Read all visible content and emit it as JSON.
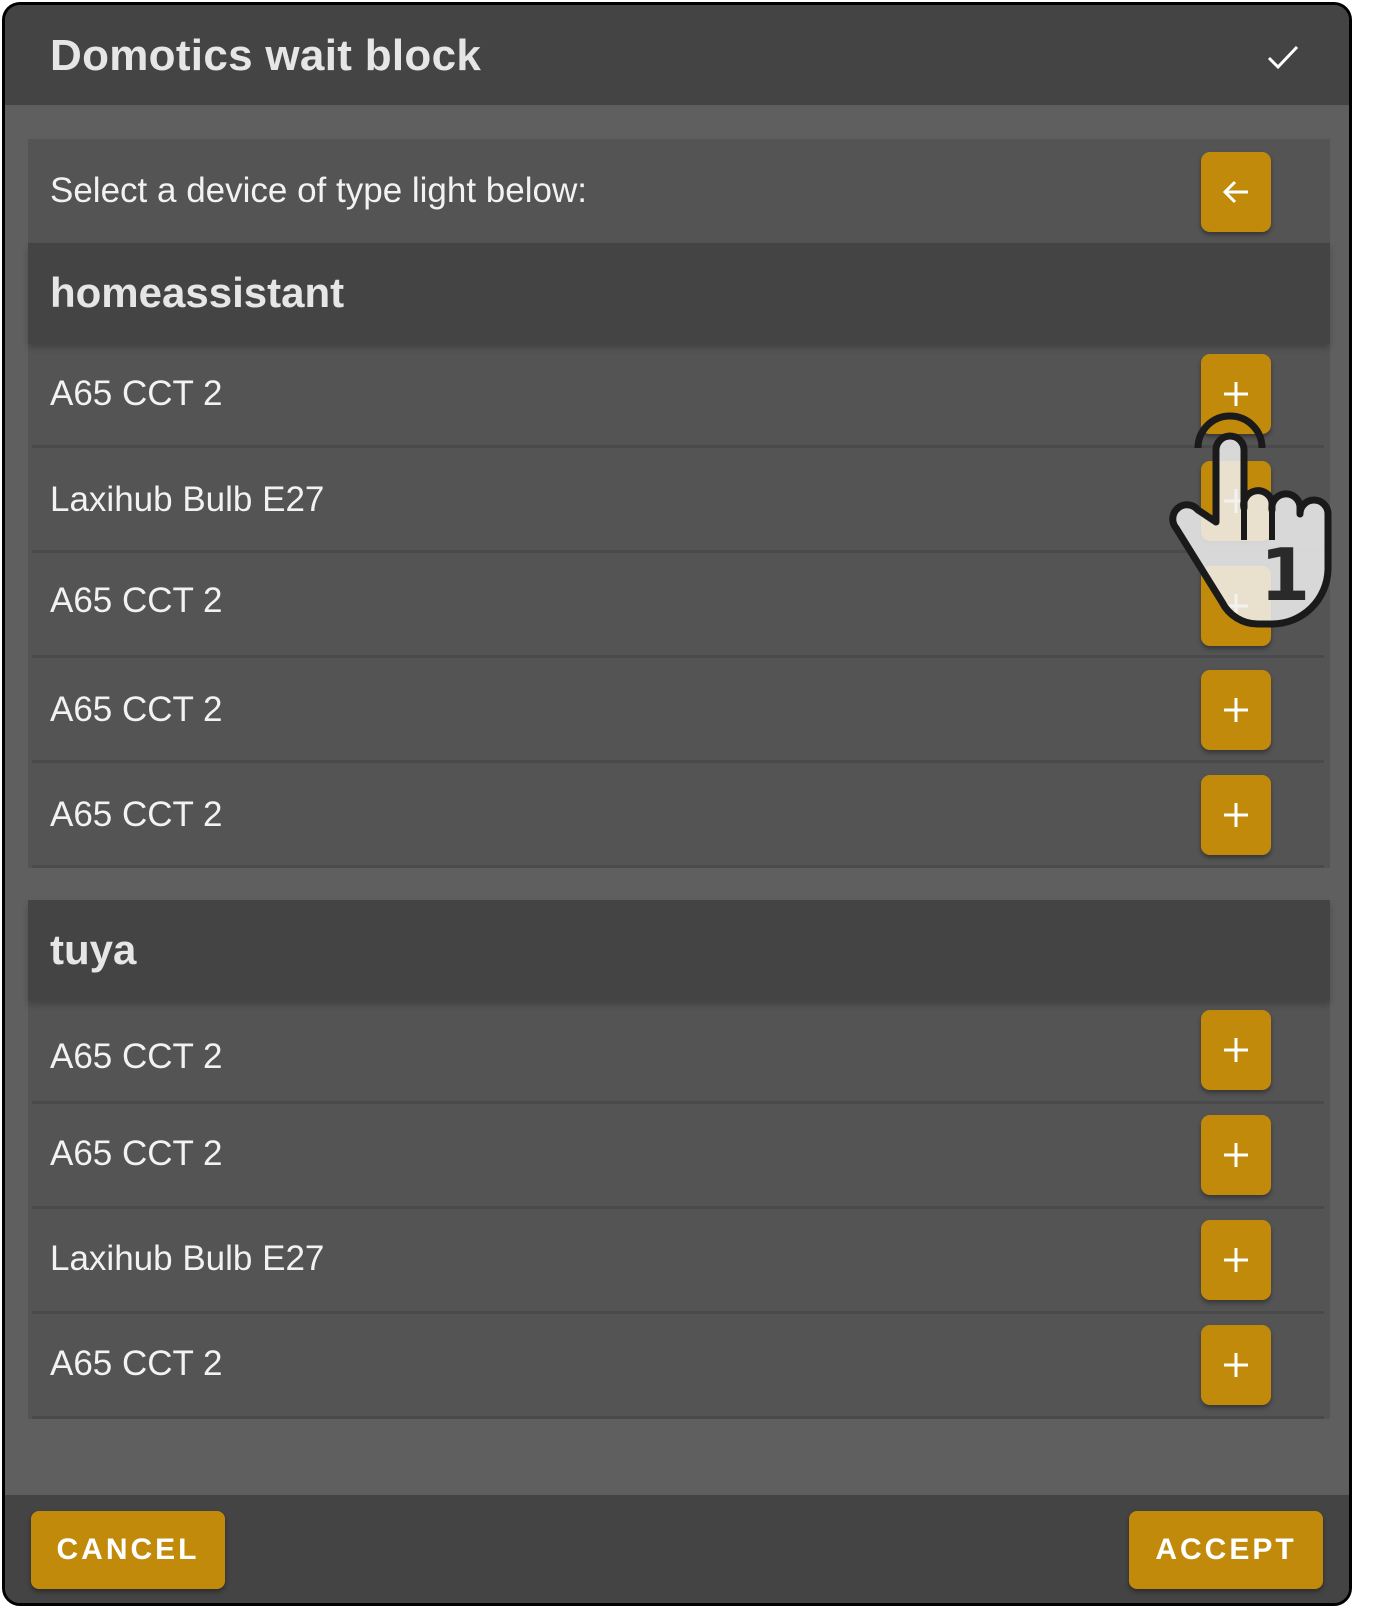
{
  "dialog": {
    "title": "Domotics wait block",
    "confirm_icon": "check-icon"
  },
  "prompt": {
    "label": "Select a device of type light below:",
    "back_icon": "arrow-left-icon"
  },
  "groups": [
    {
      "name": "homeassistant",
      "items": [
        {
          "label": "A65 CCT 2",
          "action_icon": "plus-icon"
        },
        {
          "label": "Laxihub Bulb E27",
          "action_icon": "plus-icon"
        },
        {
          "label": "A65 CCT 2",
          "action_icon": "plus-icon"
        },
        {
          "label": "A65 CCT 2",
          "action_icon": "plus-icon"
        },
        {
          "label": "A65 CCT 2",
          "action_icon": "plus-icon"
        }
      ]
    },
    {
      "name": "tuya",
      "items": [
        {
          "label": "A65 CCT 2",
          "action_icon": "plus-icon"
        },
        {
          "label": "A65 CCT 2",
          "action_icon": "plus-icon"
        },
        {
          "label": "Laxihub Bulb E27",
          "action_icon": "plus-icon"
        },
        {
          "label": "A65 CCT 2",
          "action_icon": "plus-icon"
        }
      ]
    }
  ],
  "footer": {
    "cancel_label": "CANCEL",
    "accept_label": "ACCEPT"
  },
  "overlay": {
    "cursor_icon": "hand-pointer-icon",
    "step_number": "1"
  },
  "colors": {
    "accent": "#c28a0a",
    "header_bg": "#444444",
    "panel_bg": "#545454",
    "dialog_bg": "#5f5f5f",
    "text": "#f2f2f2"
  }
}
